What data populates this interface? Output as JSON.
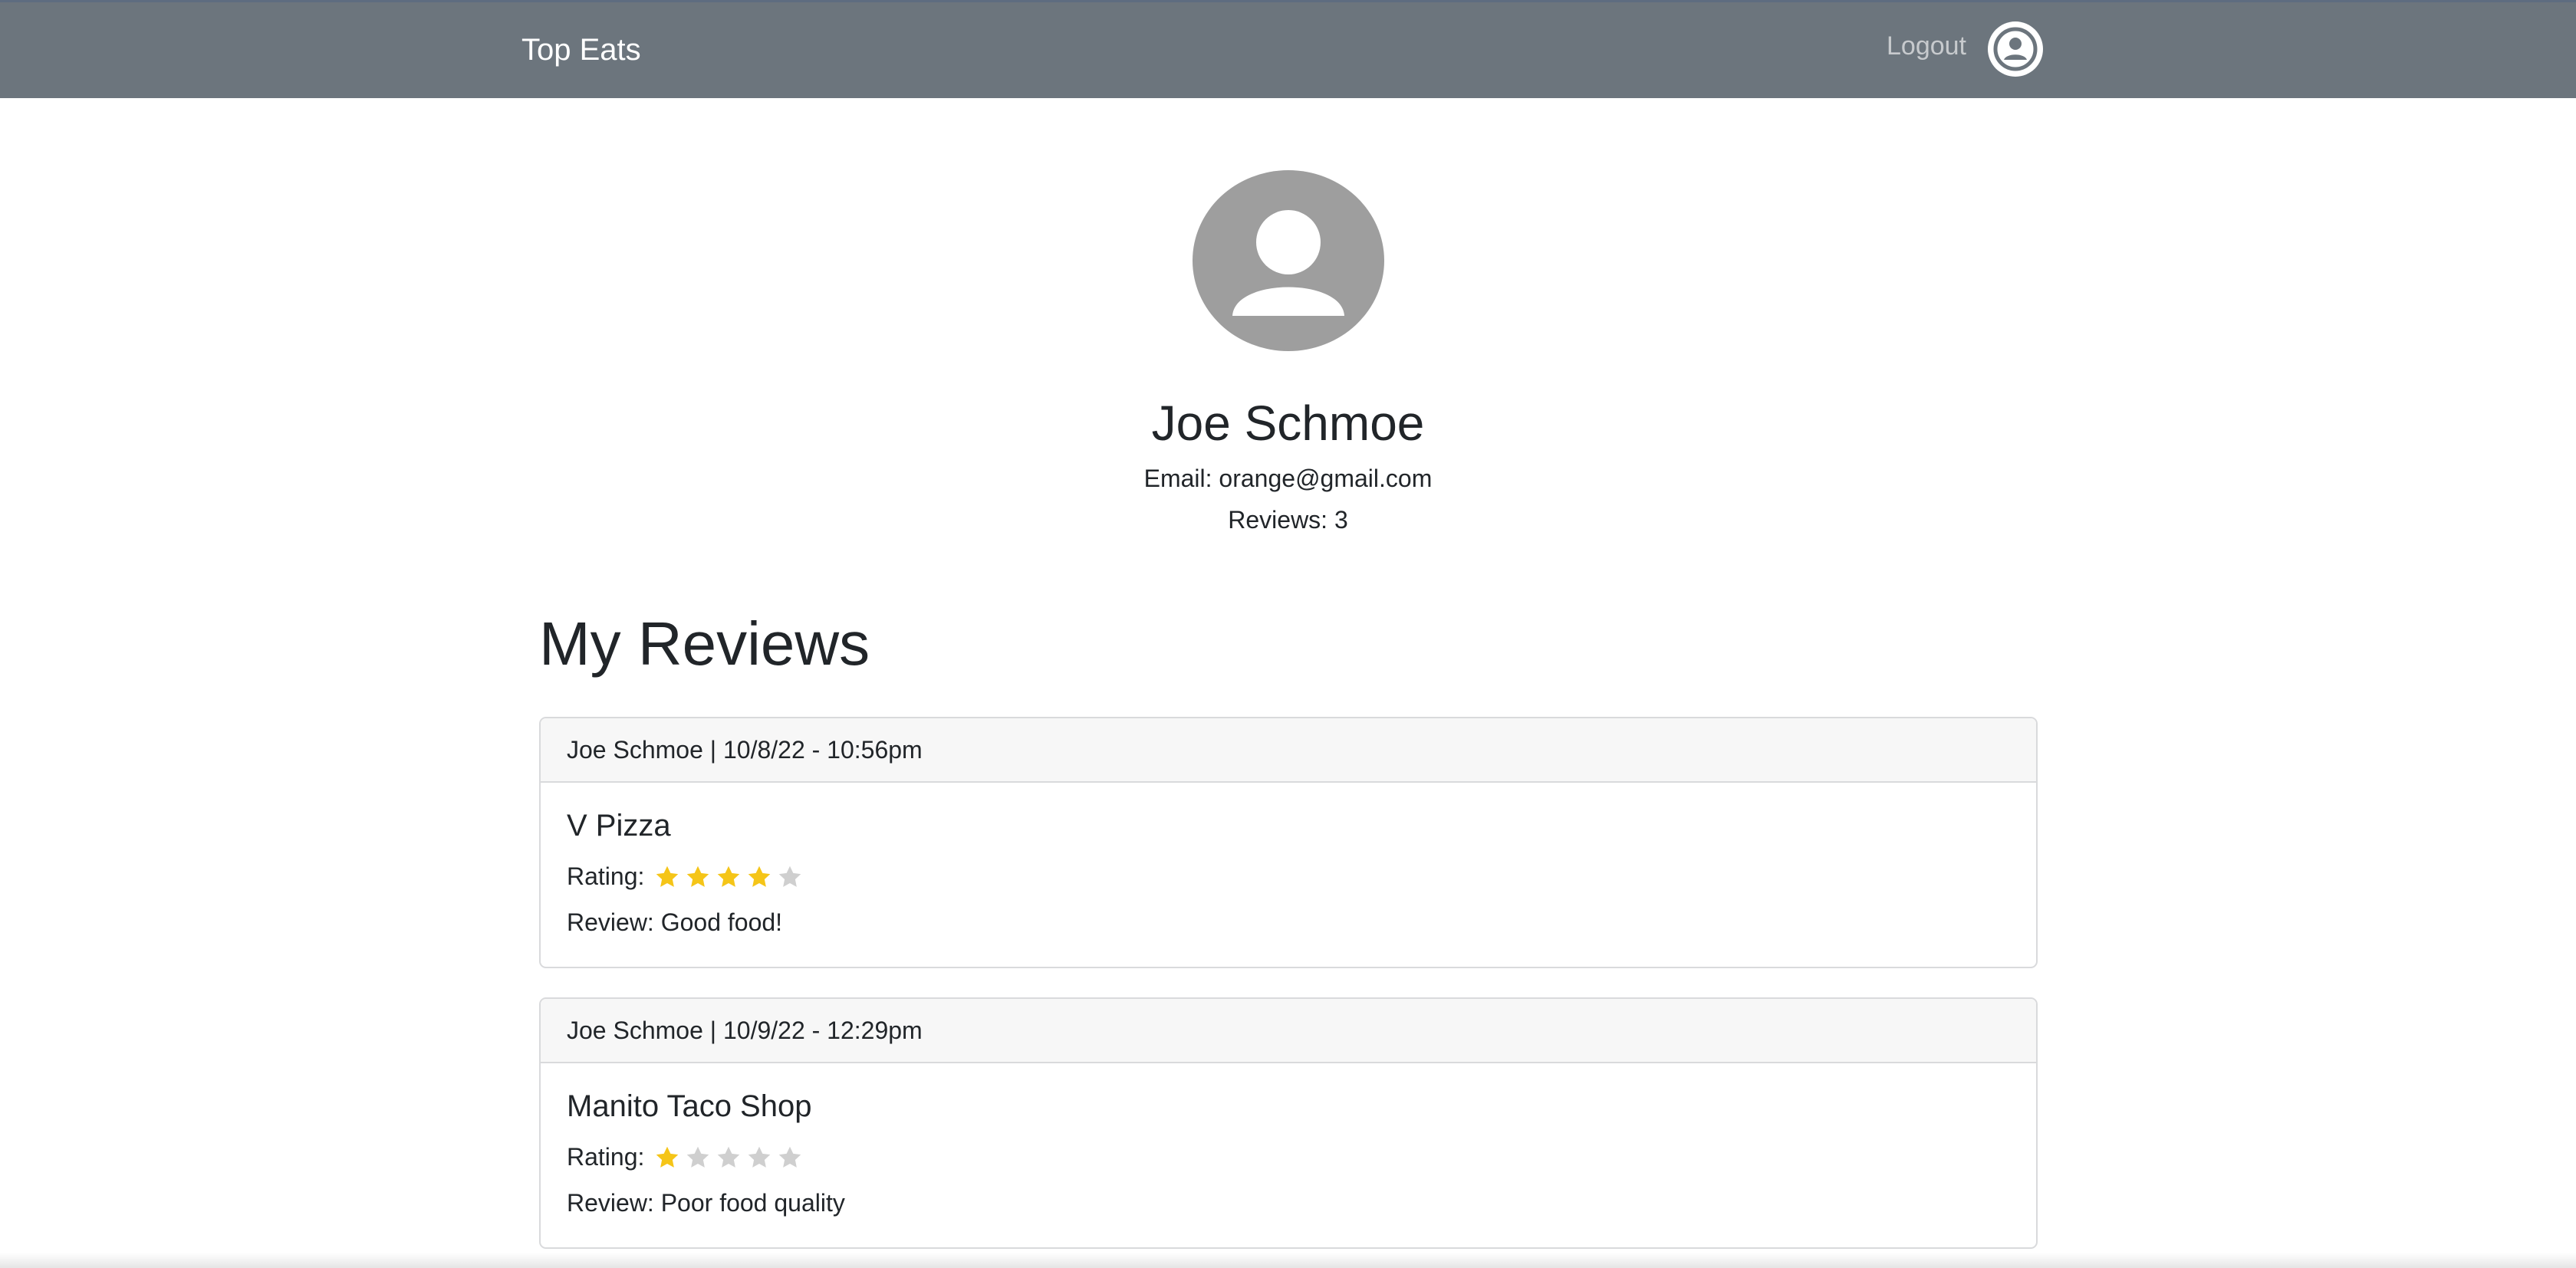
{
  "navbar": {
    "brand": "Top Eats",
    "logout_label": "Logout",
    "avatar_icon": "user-circle-icon",
    "background": "#6c757d"
  },
  "profile": {
    "name": "Joe Schmoe",
    "email_line": "Email: orange@gmail.com",
    "reviews_line": "Reviews: 3",
    "avatar_icon": "user-avatar-icon"
  },
  "reviews_section": {
    "title": "My Reviews",
    "rating_label": "Rating:",
    "star_color_filled": "#f5c518",
    "star_color_empty": "#cfcfcf",
    "items": [
      {
        "header": "Joe Schmoe | 10/8/22 - 10:56pm",
        "restaurant": "V Pizza",
        "rating": 4,
        "rating_max": 5,
        "review": "Review: Good food!"
      },
      {
        "header": "Joe Schmoe | 10/9/22 - 12:29pm",
        "restaurant": "Manito Taco Shop",
        "rating": 1,
        "rating_max": 5,
        "review": "Review: Poor food quality"
      }
    ]
  }
}
